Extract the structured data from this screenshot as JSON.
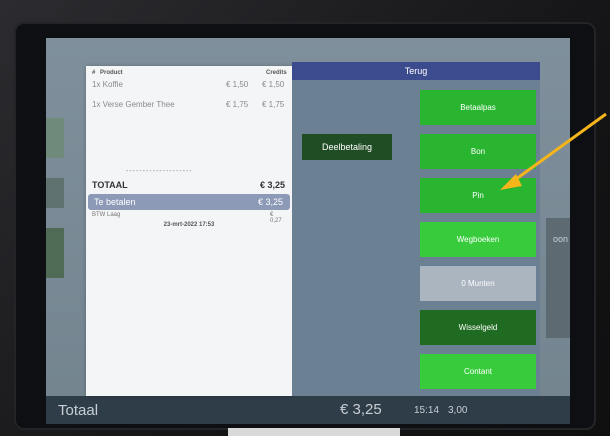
{
  "receipt": {
    "header": {
      "qty_col": "#",
      "product_col": "Product",
      "credits_col": "Credits"
    },
    "items": [
      {
        "name": "1x Koffie",
        "price": "€ 1,50",
        "total": "€ 1,50"
      },
      {
        "name": "1x Verse Gember Thee",
        "price": "€ 1,75",
        "total": "€ 1,75"
      }
    ],
    "separator": "--------------------",
    "total_label": "TOTAAL",
    "total_value": "€ 3,25",
    "to_pay_label": "Te betalen",
    "to_pay_value": "€ 3,25",
    "btw_label": "BTW Laag",
    "btw_value": "€ 0,27",
    "datetime": "23-mrt-2022 17:53"
  },
  "overlay": {
    "back_label": "Terug",
    "split_label": "Deelbetaling",
    "buttons": [
      {
        "label": "Betaalpas"
      },
      {
        "label": "Bon"
      },
      {
        "label": "Pin"
      },
      {
        "label": "Wegboeken"
      },
      {
        "label": "0 Munten"
      },
      {
        "label": "Wisselgeld"
      },
      {
        "label": "Contant"
      }
    ]
  },
  "background": {
    "bottom_label": "Totaal",
    "bottom_amount": "€ 3,25",
    "bottom_time": "15:14",
    "bottom_value": "3,00",
    "right_partial": "oon"
  },
  "colors": {
    "terug_bar": "#3c4b8e",
    "pay_green": "#29b52f",
    "pay_dark": "#206b22",
    "arrow": "#f5b51b"
  }
}
